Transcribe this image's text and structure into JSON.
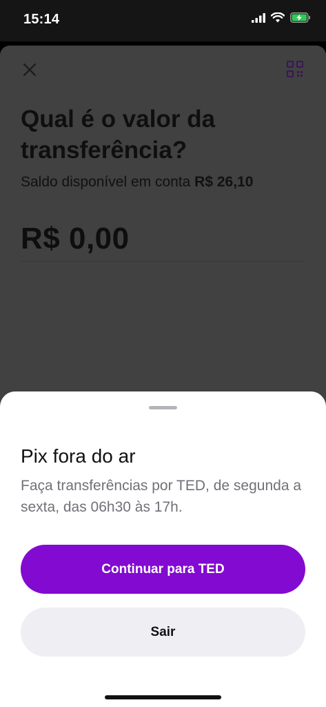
{
  "status_bar": {
    "time": "15:14",
    "icons": [
      "cellular-signal-icon",
      "wifi-icon",
      "battery-charging-icon"
    ],
    "battery_color": "#34c759"
  },
  "screen": {
    "close_icon": "close-icon",
    "qr_icon": "qr-code-icon",
    "title": "Qual é o valor da transferência?",
    "balance_label": "Saldo disponível em conta",
    "balance_value": "R$ 26,10",
    "amount": "R$ 0,00"
  },
  "sheet": {
    "title": "Pix fora do ar",
    "description": "Faça transferências por TED, de segunda a sexta, das 06h30 às 17h.",
    "primary_button": "Continuar para TED",
    "secondary_button": "Sair"
  },
  "colors": {
    "accent": "#820ad1",
    "overlay": "#414141",
    "secondary_button_bg": "#efeff3"
  }
}
